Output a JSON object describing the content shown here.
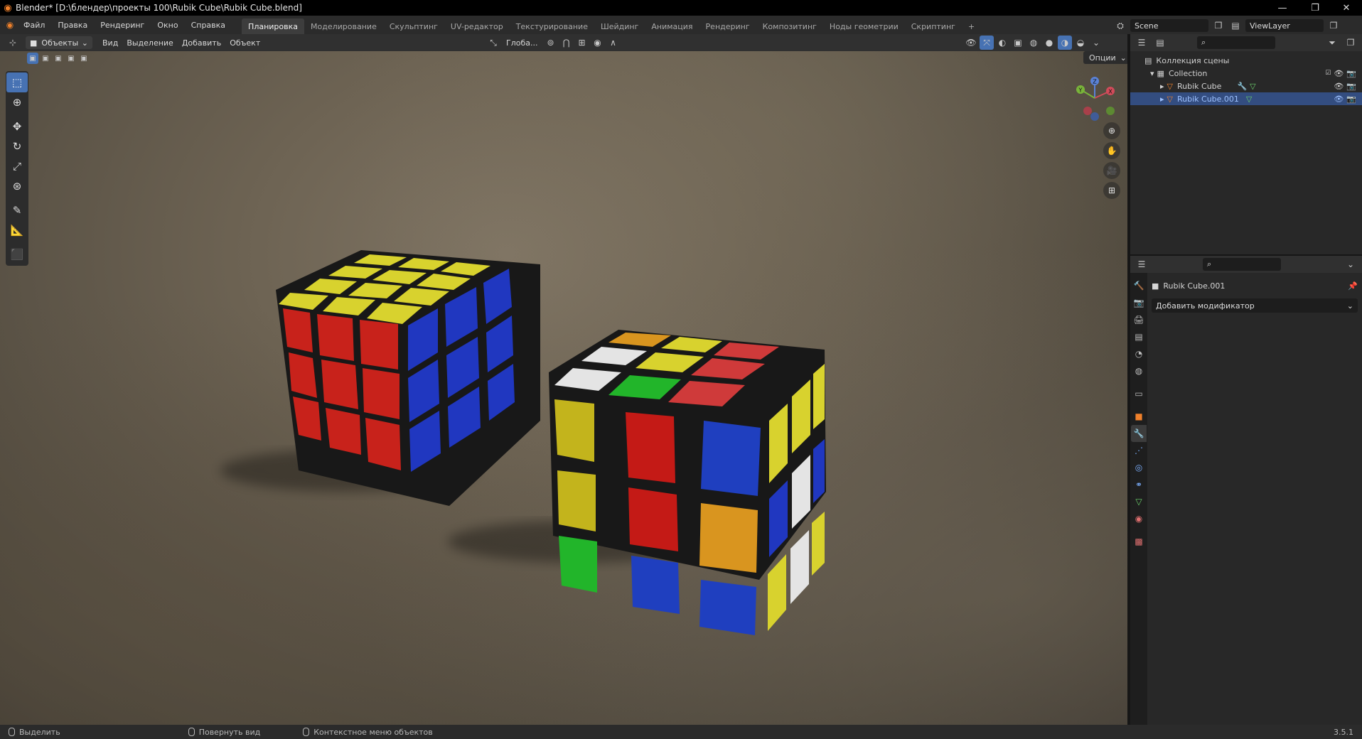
{
  "window": {
    "title": "Blender* [D:\\блендер\\проекты 100\\Rubik Cube\\Rubik Cube.blend]",
    "minimize": "—",
    "maximize": "❐",
    "close": "✕"
  },
  "menu": [
    "Файл",
    "Правка",
    "Рендеринг",
    "Окно",
    "Справка"
  ],
  "workspaces": {
    "active": "Планировка",
    "tabs": [
      "Планировка",
      "Моделирование",
      "Скульптинг",
      "UV-редактор",
      "Текстурирование",
      "Шейдинг",
      "Анимация",
      "Рендеринг",
      "Композитинг",
      "Ноды геометрии",
      "Скриптинг"
    ],
    "add": "+"
  },
  "scene": {
    "name": "Scene",
    "view_layer": "ViewLayer"
  },
  "viewport_header": {
    "mode": "Объекты",
    "menus": [
      "Вид",
      "Выделение",
      "Добавить",
      "Объект"
    ],
    "transform_orientation": "Глоба...",
    "options": "Опции"
  },
  "gizmo": {
    "x": "X",
    "y": "Y",
    "z": "Z"
  },
  "outliner": {
    "root": "Коллекция сцены",
    "collection": "Collection",
    "objects": [
      {
        "name": "Rubik Cube",
        "selected": false
      },
      {
        "name": "Rubik Cube.001",
        "selected": true
      }
    ]
  },
  "properties": {
    "object_name": "Rubik Cube.001",
    "add_modifier": "Добавить модификатор"
  },
  "statusbar": {
    "select": "Выделить",
    "rotate_view": "Повернуть вид",
    "context_menu": "Контекстное меню объектов",
    "version": "3.5.1"
  },
  "colors": {
    "accent": "#4772b3",
    "selected_row": "#334d80",
    "cube_red": "#c41a16",
    "cube_blue": "#1f3fbf",
    "cube_yellow": "#d9d22a",
    "cube_green": "#22b52a",
    "cube_orange": "#d9951f",
    "cube_white": "#e4e4e4"
  }
}
